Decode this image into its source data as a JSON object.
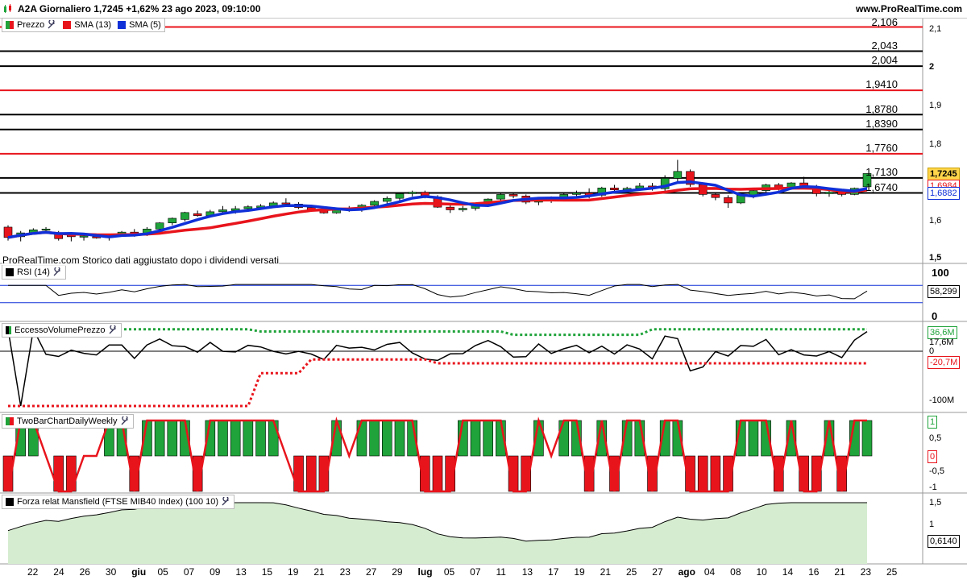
{
  "header": {
    "title": "A2A Giornaliero 1,7245 +1,62% 23 ago 2023, 09:10:00",
    "site": "www.ProRealTime.com"
  },
  "legends": {
    "price": {
      "label1": "Prezzo",
      "label2": "SMA (13)",
      "label3": "SMA (5)"
    },
    "rsi": {
      "label": "RSI (14)"
    },
    "evp": {
      "label": "EccessoVolumePrezzo"
    },
    "twobar": {
      "label": "TwoBarChartDailyWeekly"
    },
    "mansfield": {
      "label": "Forza relat Mansfield (FTSE MIB40 Index) (100 10)"
    }
  },
  "note": "ProRealTime.com  Storico dati aggiustato dopo i dividendi versati",
  "levels": [
    {
      "label": "2,106",
      "color": "red"
    },
    {
      "label": "2,043",
      "color": "black"
    },
    {
      "label": "2,004",
      "color": "black"
    },
    {
      "label": "1,9410",
      "color": "red"
    },
    {
      "label": "1,8780",
      "color": "black"
    },
    {
      "label": "1,8390",
      "color": "black"
    },
    {
      "label": "1,7760",
      "color": "red"
    },
    {
      "label": "1,7130",
      "color": "black"
    },
    {
      "label": "1,6740",
      "color": "black"
    }
  ],
  "price_axis": [
    "2,1",
    "2",
    "1,9",
    "1,8",
    "1,6",
    "1,5"
  ],
  "price_badges": {
    "last": "1,7245",
    "sma13": "1,6984",
    "sma5": "1,6882"
  },
  "rsi_axis": {
    "top": "100",
    "bottom": "0",
    "value": "58,299"
  },
  "evp_axis": {
    "v1": "36,6M",
    "v2": "17,6M",
    "v3": "0",
    "v4": "-20,7M",
    "v5": "-100M"
  },
  "twobar_axis": {
    "a1": "1",
    "a2": "0,5",
    "a3": "0",
    "a4": "-0,5",
    "a5": "-1"
  },
  "mansfield_axis": {
    "a1": "1,5",
    "a2": "1",
    "value": "0,6140"
  },
  "x_axis": [
    "22",
    "24",
    "26",
    "30",
    "giu",
    "05",
    "07",
    "09",
    "13",
    "15",
    "19",
    "21",
    "23",
    "27",
    "29",
    "lug",
    "05",
    "07",
    "11",
    "13",
    "17",
    "19",
    "21",
    "25",
    "27",
    "ago",
    "04",
    "08",
    "10",
    "14",
    "16",
    "21",
    "23",
    "25"
  ],
  "colors": {
    "up": "#1fa33a",
    "down": "#e8141c",
    "sma13": "#e8141c",
    "sma5": "#1030d8",
    "levelRed": "#e8141c"
  },
  "chart_data": {
    "type": "candlestick",
    "candles": [
      [
        1.585,
        1.59,
        1.55,
        1.558
      ],
      [
        1.56,
        1.575,
        1.548,
        1.57
      ],
      [
        1.57,
        1.582,
        1.565,
        1.578
      ],
      [
        1.578,
        1.585,
        1.57,
        1.58
      ],
      [
        1.57,
        1.575,
        1.55,
        1.555
      ],
      [
        1.565,
        1.57,
        1.548,
        1.56
      ],
      [
        1.56,
        1.568,
        1.55,
        1.562
      ],
      [
        1.56,
        1.566,
        1.555,
        1.558
      ],
      [
        1.558,
        1.565,
        1.55,
        1.563
      ],
      [
        1.563,
        1.575,
        1.56,
        1.572
      ],
      [
        1.572,
        1.58,
        1.56,
        1.566
      ],
      [
        1.566,
        1.585,
        1.562,
        1.58
      ],
      [
        1.58,
        1.598,
        1.575,
        1.596
      ],
      [
        1.596,
        1.61,
        1.59,
        1.608
      ],
      [
        1.605,
        1.625,
        1.6,
        1.623
      ],
      [
        1.62,
        1.628,
        1.612,
        1.615
      ],
      [
        1.615,
        1.63,
        1.61,
        1.625
      ],
      [
        1.625,
        1.64,
        1.62,
        1.63
      ],
      [
        1.628,
        1.64,
        1.62,
        1.633
      ],
      [
        1.633,
        1.642,
        1.628,
        1.638
      ],
      [
        1.636,
        1.645,
        1.63,
        1.64
      ],
      [
        1.64,
        1.652,
        1.635,
        1.648
      ],
      [
        1.648,
        1.66,
        1.64,
        1.645
      ],
      [
        1.645,
        1.65,
        1.632,
        1.636
      ],
      [
        1.636,
        1.642,
        1.625,
        1.63
      ],
      [
        1.63,
        1.636,
        1.62,
        1.622
      ],
      [
        1.622,
        1.635,
        1.62,
        1.632
      ],
      [
        1.632,
        1.64,
        1.625,
        1.63
      ],
      [
        1.63,
        1.645,
        1.625,
        1.642
      ],
      [
        1.642,
        1.655,
        1.638,
        1.652
      ],
      [
        1.652,
        1.665,
        1.645,
        1.66
      ],
      [
        1.66,
        1.675,
        1.65,
        1.672
      ],
      [
        1.672,
        1.68,
        1.665,
        1.676
      ],
      [
        1.676,
        1.68,
        1.66,
        1.664
      ],
      [
        1.664,
        1.668,
        1.635,
        1.637
      ],
      [
        1.637,
        1.642,
        1.622,
        1.63
      ],
      [
        1.63,
        1.64,
        1.625,
        1.634
      ],
      [
        1.634,
        1.648,
        1.628,
        1.645
      ],
      [
        1.645,
        1.66,
        1.64,
        1.658
      ],
      [
        1.658,
        1.672,
        1.652,
        1.67
      ],
      [
        1.67,
        1.675,
        1.66,
        1.666
      ],
      [
        1.666,
        1.67,
        1.645,
        1.65
      ],
      [
        1.65,
        1.662,
        1.642,
        1.658
      ],
      [
        1.658,
        1.665,
        1.648,
        1.66
      ],
      [
        1.66,
        1.675,
        1.655,
        1.67
      ],
      [
        1.67,
        1.68,
        1.665,
        1.674
      ],
      [
        1.674,
        1.686,
        1.66,
        1.668
      ],
      [
        1.668,
        1.69,
        1.664,
        1.687
      ],
      [
        1.687,
        1.695,
        1.678,
        1.682
      ],
      [
        1.682,
        1.69,
        1.675,
        1.686
      ],
      [
        1.686,
        1.7,
        1.68,
        1.692
      ],
      [
        1.692,
        1.7,
        1.68,
        1.685
      ],
      [
        1.685,
        1.72,
        1.678,
        1.712
      ],
      [
        1.712,
        1.76,
        1.7,
        1.73
      ],
      [
        1.73,
        1.735,
        1.69,
        1.696
      ],
      [
        1.696,
        1.7,
        1.665,
        1.67
      ],
      [
        1.67,
        1.675,
        1.655,
        1.662
      ],
      [
        1.662,
        1.668,
        1.635,
        1.648
      ],
      [
        1.648,
        1.672,
        1.645,
        1.668
      ],
      [
        1.668,
        1.685,
        1.66,
        1.68
      ],
      [
        1.68,
        1.698,
        1.675,
        1.695
      ],
      [
        1.695,
        1.7,
        1.68,
        1.688
      ],
      [
        1.688,
        1.702,
        1.682,
        1.7
      ],
      [
        1.7,
        1.716,
        1.69,
        1.69
      ],
      [
        1.69,
        1.695,
        1.665,
        1.672
      ],
      [
        1.672,
        1.68,
        1.664,
        1.676
      ],
      [
        1.676,
        1.682,
        1.665,
        1.67
      ],
      [
        1.67,
        1.688,
        1.668,
        1.686
      ],
      [
        1.69,
        1.725,
        1.688,
        1.7245
      ]
    ]
  }
}
